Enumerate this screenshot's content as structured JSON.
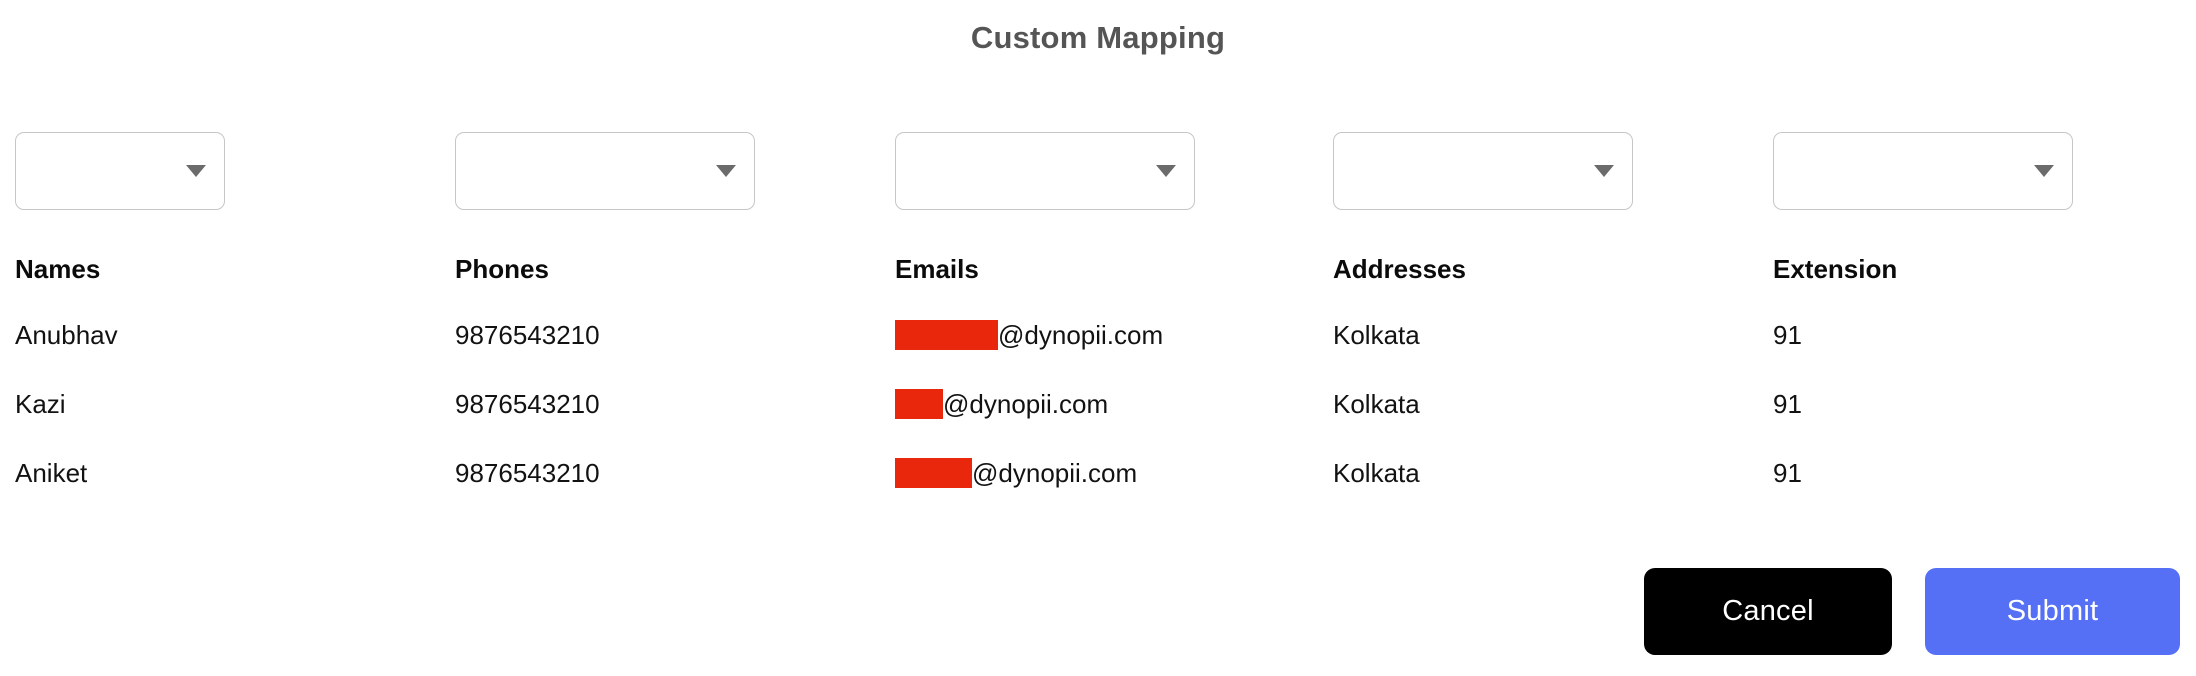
{
  "page": {
    "title": "Custom Mapping",
    "title_color": "#555555",
    "background": "#ffffff"
  },
  "mapping": {
    "selects": [
      {
        "name": "names-mapping-select",
        "value": "",
        "placeholder": "",
        "arrow_icon": "chevron-down-icon"
      },
      {
        "name": "phones-mapping-select",
        "value": "",
        "placeholder": "",
        "arrow_icon": "chevron-down-icon"
      },
      {
        "name": "emails-mapping-select",
        "value": "",
        "placeholder": "",
        "arrow_icon": "chevron-down-icon"
      },
      {
        "name": "addresses-mapping-select",
        "value": "",
        "placeholder": "",
        "arrow_icon": "chevron-down-icon"
      },
      {
        "name": "extension-mapping-select",
        "value": "",
        "placeholder": "",
        "arrow_icon": "chevron-down-icon"
      }
    ],
    "columns": [
      "Names",
      "Phones",
      "Emails",
      "Addresses",
      "Extension"
    ],
    "rows": [
      {
        "name": "Anubhav",
        "phone": "9876543210",
        "email_redacted_width": 103,
        "email_domain": "@dynopii.com",
        "address": "Kolkata",
        "extension": "91"
      },
      {
        "name": "Kazi",
        "phone": "9876543210",
        "email_redacted_width": 48,
        "email_domain": "@dynopii.com",
        "address": "Kolkata",
        "extension": "91"
      },
      {
        "name": "Aniket",
        "phone": "9876543210",
        "email_redacted_width": 77,
        "email_domain": "@dynopii.com",
        "address": "Kolkata",
        "extension": "91"
      }
    ],
    "redaction_color": "#E8270C"
  },
  "footer": {
    "cancel_label": "Cancel",
    "submit_label": "Submit",
    "cancel_color": "#000000",
    "submit_color": "#5570F4"
  }
}
